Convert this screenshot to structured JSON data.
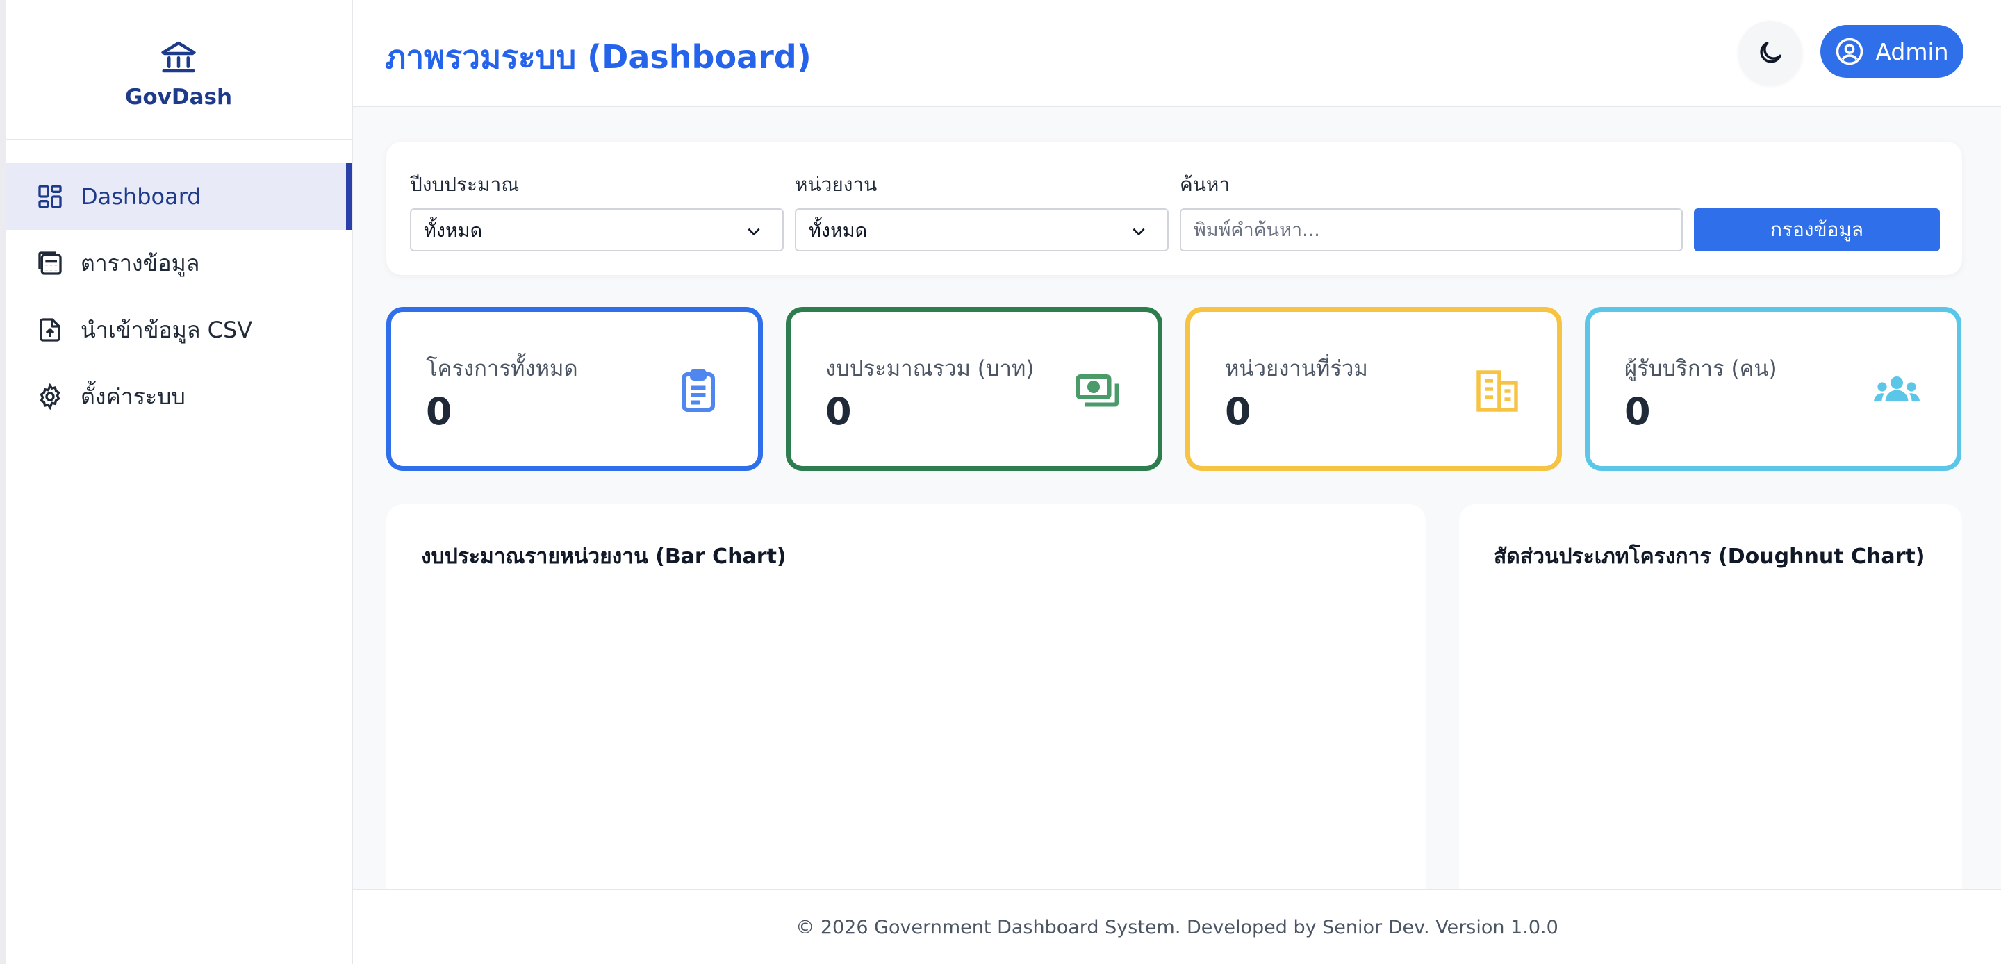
{
  "brand": {
    "name": "GovDash",
    "icon": "bank-icon"
  },
  "sidebar": {
    "items": [
      {
        "label": "Dashboard",
        "icon": "dashboard-grid-icon",
        "active": true
      },
      {
        "label": "ตารางข้อมูล",
        "icon": "table-calculator-icon",
        "active": false
      },
      {
        "label": "นำเข้าข้อมูล CSV",
        "icon": "file-upload-icon",
        "active": false
      },
      {
        "label": "ตั้งค่าระบบ",
        "icon": "gear-icon",
        "active": false
      }
    ]
  },
  "header": {
    "title": "ภาพรวมระบบ (Dashboard)",
    "theme_icon": "moon-icon",
    "user_label": "Admin",
    "user_icon": "user-circle-icon"
  },
  "filters": {
    "year": {
      "label": "ปีงบประมาณ",
      "value": "ทั้งหมด"
    },
    "agency": {
      "label": "หน่วยงาน",
      "value": "ทั้งหมด"
    },
    "search": {
      "label": "ค้นหา",
      "placeholder": "พิมพ์คำค้นหา...",
      "value": ""
    },
    "button_label": "กรองข้อมูล"
  },
  "stats": [
    {
      "label": "โครงการทั้งหมด",
      "value": "0",
      "icon": "clipboard-icon",
      "color": "#2f6fea"
    },
    {
      "label": "งบประมาณรวม (บาท)",
      "value": "0",
      "icon": "money-icon",
      "color": "#2e7d4f"
    },
    {
      "label": "หน่วยงานที่ร่วม",
      "value": "0",
      "icon": "building-icon",
      "color": "#f6c343"
    },
    {
      "label": "ผู้รับบริการ (คน)",
      "value": "0",
      "icon": "users-icon",
      "color": "#5bc6e8"
    }
  ],
  "charts": {
    "bar_title": "งบประมาณรายหน่วยงาน (Bar Chart)",
    "doughnut_title": "สัดส่วนประเภทโครงการ (Doughnut Chart)"
  },
  "footer": {
    "text": "© 2026 Government Dashboard System. Developed by Senior Dev. Version 1.0.0"
  }
}
